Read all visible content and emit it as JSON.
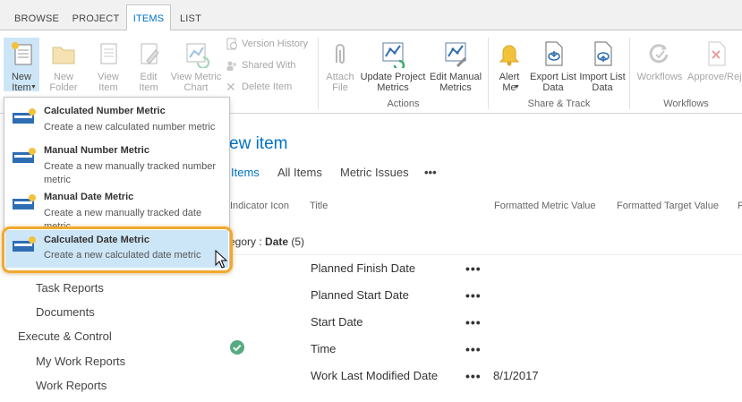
{
  "tabs": [
    {
      "label": "BROWSE",
      "active": false
    },
    {
      "label": "PROJECT",
      "active": false
    },
    {
      "label": "ITEMS",
      "active": true
    },
    {
      "label": "LIST",
      "active": false
    }
  ],
  "ribbon": {
    "new_item_label": "New Item",
    "new_folder_label": "New Folder",
    "view_item_label": "View Item",
    "edit_item_label": "Edit Item",
    "view_metric_chart_label": "View Metric Chart",
    "version_history_label": "Version History",
    "shared_with_label": "Shared With",
    "delete_item_label": "Delete Item",
    "attach_file_label": "Attach File",
    "update_project_metrics_label": "Update Project Metrics",
    "edit_manual_metrics_label": "Edit Manual Metrics",
    "alert_me_label": "Alert Me",
    "export_list_data_label": "Export List Data",
    "import_list_data_label": "Import List Data",
    "workflows_label": "Workflows",
    "approve_reject_label": "Approve/Rej",
    "groups": {
      "actions": "Actions",
      "share_track": "Share & Track",
      "workflows": "Workflows"
    }
  },
  "dropdown": {
    "items": [
      {
        "title": "Calculated Number Metric",
        "description": "Create a new calculated number metric",
        "selected": false
      },
      {
        "title": "Manual Number Metric",
        "description": "Create a new manually tracked number metric",
        "selected": false
      },
      {
        "title": "Manual Date Metric",
        "description": "Create a new manually tracked date metric",
        "selected": false
      },
      {
        "title": "Calculated Date Metric",
        "description": "Create a new calculated date metric",
        "selected": true
      }
    ]
  },
  "page": {
    "title_fragment": "ew item",
    "view_tabs": [
      "Items",
      "All Items",
      "Metric Issues",
      "•••"
    ],
    "columns": [
      "Indicator Icon",
      "Title",
      "Formatted Metric Value",
      "Formatted Target Value",
      "F"
    ],
    "group_prefix": "egory : ",
    "group_name": "Date",
    "group_count": "(5)",
    "rows": [
      {
        "title": "Planned Finish Date",
        "dots": "•••",
        "value": ""
      },
      {
        "title": "Planned Start Date",
        "dots": "•••",
        "value": ""
      },
      {
        "title": "Start Date",
        "dots": "•••",
        "value": ""
      },
      {
        "title": "Time",
        "dots": "•••",
        "value": ""
      },
      {
        "title": "Work Last Modified Date",
        "dots": "•••",
        "value": "8/1/2017"
      }
    ]
  },
  "left_nav": {
    "items": [
      {
        "label": "Task Reports",
        "level": 2
      },
      {
        "label": "Documents",
        "level": 2
      },
      {
        "label": "Execute & Control",
        "level": 1
      },
      {
        "label": "My Work Reports",
        "level": 2
      },
      {
        "label": "Work Reports",
        "level": 2
      }
    ]
  },
  "colors": {
    "accent": "#0072c6",
    "selected_bg": "#cde6f7",
    "highlight_ring": "#f0a830",
    "check_green": "#55ab80"
  }
}
